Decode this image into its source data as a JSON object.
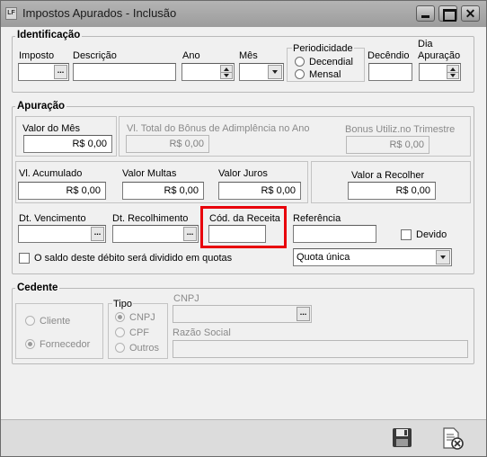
{
  "window": {
    "app_icon_text": "LF",
    "title": "Impostos Apurados  - Inclusão",
    "close_glyph": "✕"
  },
  "identificacao": {
    "title": "Identificação",
    "imposto_label": "Imposto",
    "descricao_label": "Descrição",
    "ano_label": "Ano",
    "mes_label": "Mês",
    "periodicidade_label": "Periodicidade",
    "decendial_label": "Decendial",
    "mensal_label": "Mensal",
    "decendio_label": "Decêndio",
    "dia_apuracao_label_1": "Dia",
    "dia_apuracao_label_2": "Apuração",
    "ellipsis": "..."
  },
  "apuracao": {
    "title": "Apuração",
    "valor_mes_label": "Valor do Mês",
    "valor_mes_value": "R$ 0,00",
    "total_bonus_label": "Vl. Total do Bônus de Adimplência no Ano",
    "total_bonus_value": "R$ 0,00",
    "bonus_utiliz_label": "Bonus Utiliz.no Trimestre",
    "bonus_utiliz_value": "R$ 0,00",
    "acumulado_label": "Vl. Acumulado",
    "acumulado_value": "R$ 0,00",
    "multas_label": "Valor Multas",
    "multas_value": "R$ 0,00",
    "juros_label": "Valor Juros",
    "juros_value": "R$ 0,00",
    "recolher_label": "Valor a Recolher",
    "recolher_value": "R$ 0,00",
    "vencimento_label": "Dt. Vencimento",
    "recolhimento_label": "Dt. Recolhimento",
    "cod_receita_label": "Cód. da Receita",
    "referencia_label": "Referência",
    "devido_label": "Devido",
    "quotas_label": "O saldo deste débito será dividido em quotas",
    "quota_option": "Quota única"
  },
  "cedente": {
    "title": "Cedente",
    "cliente_label": "Cliente",
    "fornecedor_label": "Fornecedor",
    "tipo_label": "Tipo",
    "cnpj_option": "CNPJ",
    "cpf_option": "CPF",
    "outros_option": "Outros",
    "cnpj_label": "CNPJ",
    "razao_social_label": "Razão Social"
  },
  "toolbar": {
    "save_icon": "floppy-disk-icon",
    "cancel_icon": "cancel-document-icon"
  },
  "colors": {
    "highlight": "#e8000b",
    "titlebar": "#a8a8a8"
  }
}
